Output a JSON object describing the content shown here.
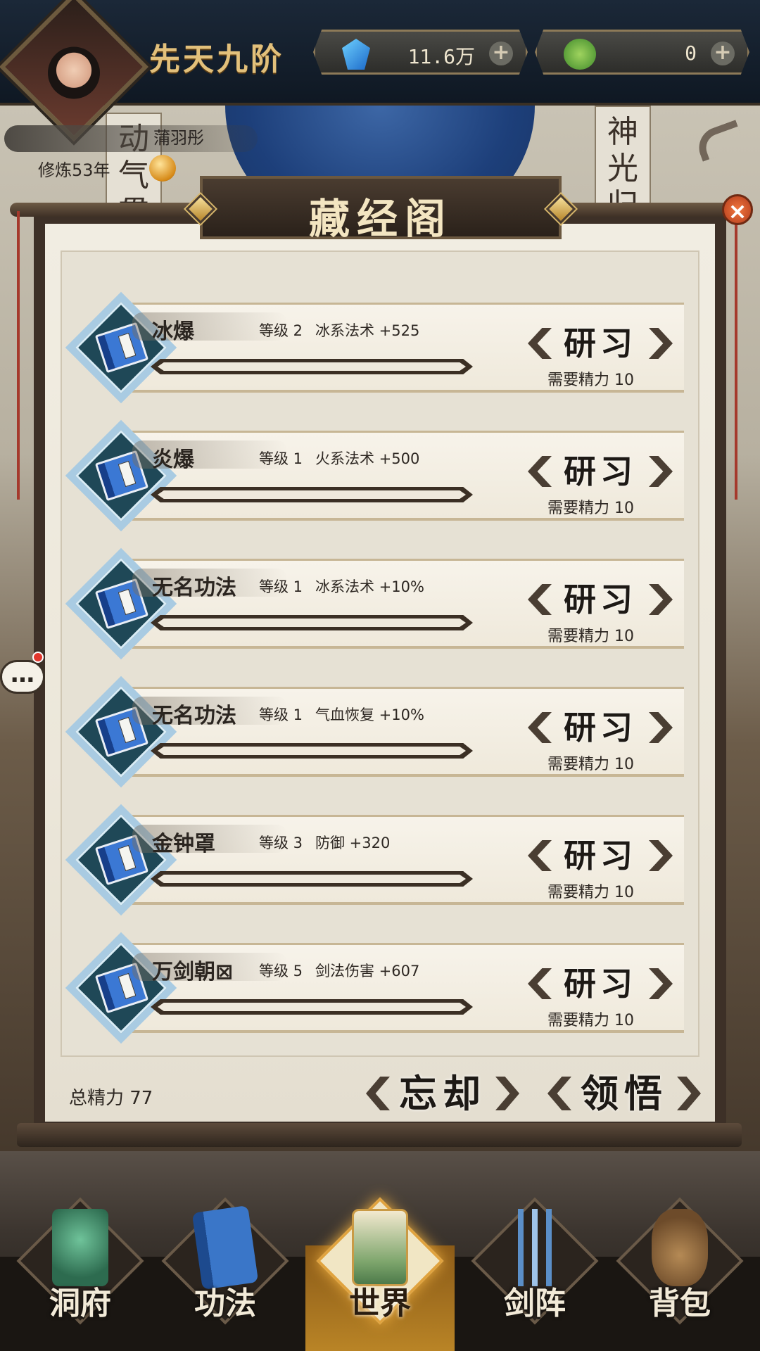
{
  "header": {
    "realm": "先天九阶",
    "resources": [
      {
        "name": "jade",
        "icon": "blue-gem-icon",
        "value": "11.6万"
      },
      {
        "name": "coin",
        "icon": "green-coin-icon",
        "value": "0"
      }
    ],
    "player_name": "蒲羽彤",
    "cultivation_years": "修炼53年"
  },
  "scene": {
    "pillar_left": "动气贯",
    "pillar_right": "神光归"
  },
  "panel": {
    "title": "藏经阁",
    "close_icon": "close-icon",
    "skills": [
      {
        "name": "冰爆",
        "level": "等级 2",
        "bonus": "冰系法术 +525",
        "action": "研习",
        "cost": "需要精力 10",
        "progress": 0
      },
      {
        "name": "炎爆",
        "level": "等级 1",
        "bonus": "火系法术 +500",
        "action": "研习",
        "cost": "需要精力 10",
        "progress": 0
      },
      {
        "name": "无名功法",
        "level": "等级 1",
        "bonus": "冰系法术 +10%",
        "action": "研习",
        "cost": "需要精力 10",
        "progress": 0
      },
      {
        "name": "无名功法",
        "level": "等级 1",
        "bonus": "气血恢复 +10%",
        "action": "研习",
        "cost": "需要精力 10",
        "progress": 0
      },
      {
        "name": "金钟罩",
        "level": "等级 3",
        "bonus": "防御 +320",
        "action": "研习",
        "cost": "需要精力 10",
        "progress": 0
      },
      {
        "name": "万剑朝⊠",
        "level": "等级 5",
        "bonus": "剑法伤害 +607",
        "action": "研习",
        "cost": "需要精力 10",
        "progress": 0
      }
    ],
    "total_energy": "总精力 77",
    "forget_label": "忘却",
    "comprehend_label": "领悟"
  },
  "chat": {
    "label": "…"
  },
  "nav": {
    "items": [
      {
        "label": "洞府",
        "icon": "cave-dwelling-icon",
        "active": false
      },
      {
        "label": "功法",
        "icon": "skill-book-icon",
        "active": false
      },
      {
        "label": "世界",
        "icon": "world-scroll-icon",
        "active": true
      },
      {
        "label": "剑阵",
        "icon": "sword-formation-icon",
        "active": false
      },
      {
        "label": "背包",
        "icon": "bag-icon",
        "active": false
      }
    ]
  },
  "colors": {
    "paper": "#efe9db",
    "frame": "#3d3027",
    "accent_gold": "#e2c07b",
    "icon_diamond": "#1f4857",
    "book_blue": "#3b78d4"
  }
}
